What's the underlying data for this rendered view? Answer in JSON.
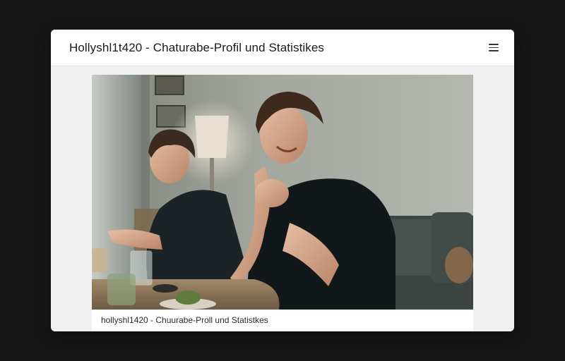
{
  "window": {
    "title": "Hollyshl1t420 - Chaturabe-Profil und Statistikes",
    "menu_icon": "hamburger-menu-icon"
  },
  "photo": {
    "description_icon": "photo-image",
    "caption": "hollyshl1420 - Chuurabe-Proll und Statistkes"
  },
  "colors": {
    "page_background": "#171717",
    "window_background": "#f1f1f1",
    "header_background": "#ffffff"
  }
}
